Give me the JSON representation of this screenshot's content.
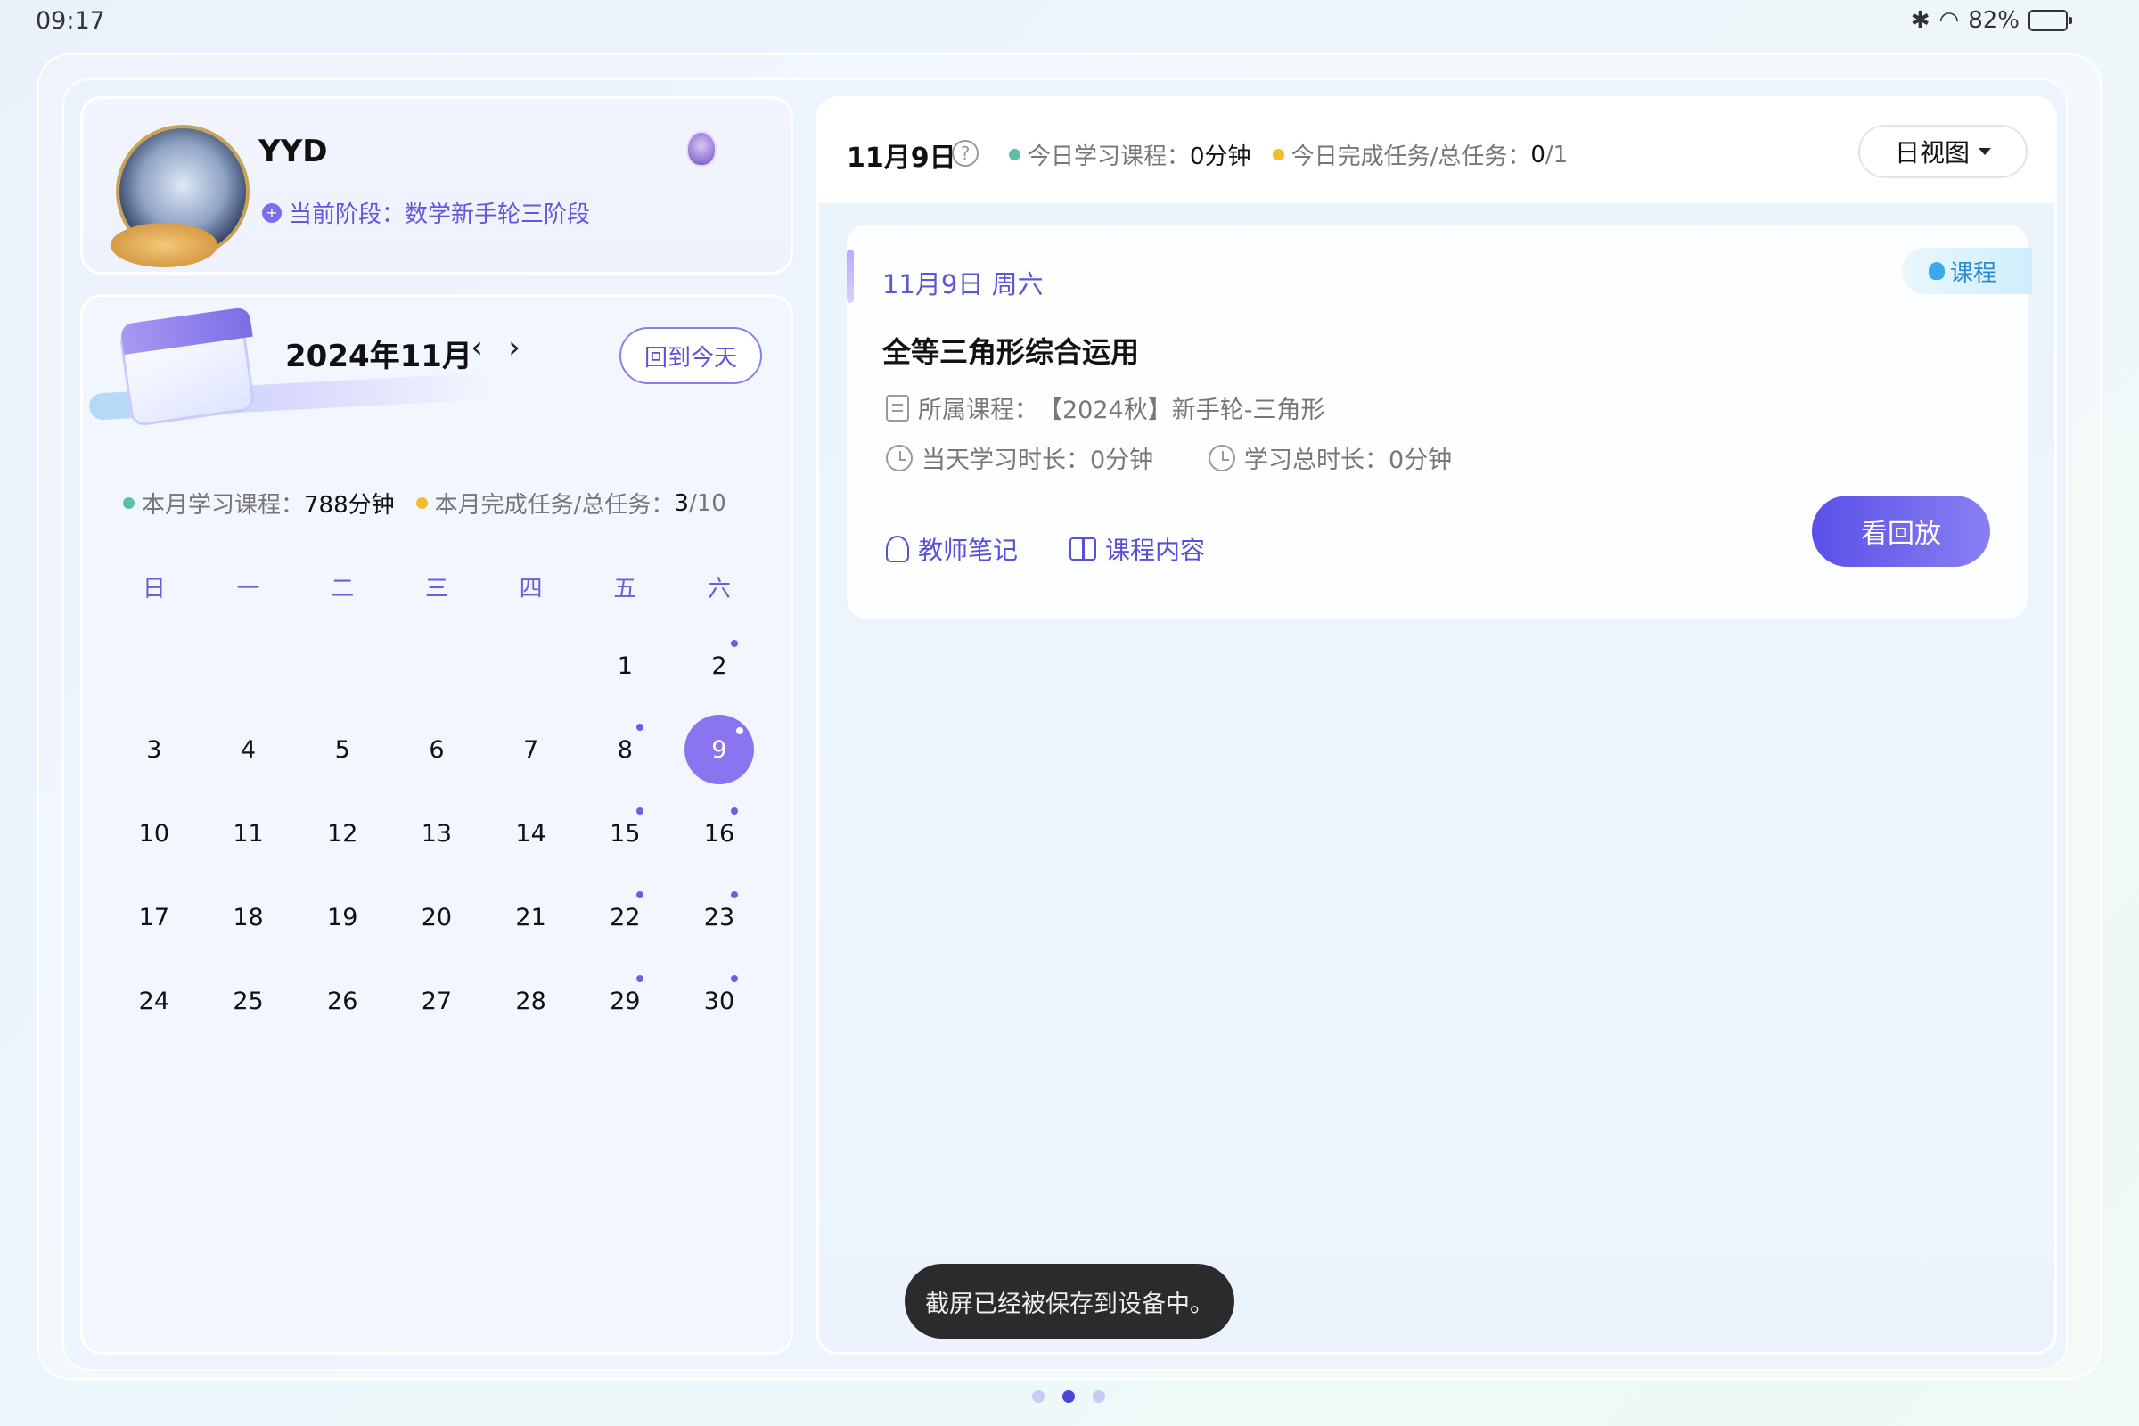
{
  "status_bar": {
    "time": "09:17",
    "battery": "82%",
    "battery_level": 0.82
  },
  "profile": {
    "name": "YYD",
    "stage": "当前阶段：数学新手轮三阶段"
  },
  "calendar": {
    "month_title": "2024年11月",
    "prev_label": "‹",
    "next_label": "›",
    "today_button": "回到今天",
    "stats": {
      "study_label": "本月学习课程：",
      "study_value": "788分钟",
      "task_label": "本月完成任务/总任务：",
      "task_done": "3",
      "task_total": "/10"
    },
    "weekdays": [
      "日",
      "一",
      "二",
      "三",
      "四",
      "五",
      "六"
    ],
    "leading_blanks": 5,
    "days": [
      {
        "n": "1",
        "mark": false
      },
      {
        "n": "2",
        "mark": true
      },
      {
        "n": "3",
        "mark": false
      },
      {
        "n": "4",
        "mark": false
      },
      {
        "n": "5",
        "mark": false
      },
      {
        "n": "6",
        "mark": false
      },
      {
        "n": "7",
        "mark": false
      },
      {
        "n": "8",
        "mark": true
      },
      {
        "n": "9",
        "mark": true,
        "selected": true
      },
      {
        "n": "10",
        "mark": false
      },
      {
        "n": "11",
        "mark": false
      },
      {
        "n": "12",
        "mark": false
      },
      {
        "n": "13",
        "mark": false
      },
      {
        "n": "14",
        "mark": false
      },
      {
        "n": "15",
        "mark": true
      },
      {
        "n": "16",
        "mark": true
      },
      {
        "n": "17",
        "mark": false
      },
      {
        "n": "18",
        "mark": false
      },
      {
        "n": "19",
        "mark": false
      },
      {
        "n": "20",
        "mark": false
      },
      {
        "n": "21",
        "mark": false
      },
      {
        "n": "22",
        "mark": true
      },
      {
        "n": "23",
        "mark": true
      },
      {
        "n": "24",
        "mark": false
      },
      {
        "n": "25",
        "mark": false
      },
      {
        "n": "26",
        "mark": false
      },
      {
        "n": "27",
        "mark": false
      },
      {
        "n": "28",
        "mark": false
      },
      {
        "n": "29",
        "mark": true
      },
      {
        "n": "30",
        "mark": true
      }
    ]
  },
  "day_header": {
    "date": "11月9日",
    "help": "?",
    "study_label": "今日学习课程：",
    "study_value": "0分钟",
    "task_label": "今日完成任务/总任务：",
    "task_done": "0",
    "task_total": "/1",
    "view_button": "日视图"
  },
  "course": {
    "date": "11月9日 周六",
    "tag": "课程",
    "title": "全等三角形综合运用",
    "belongs_label": "所属课程：",
    "belongs_value": "【2024秋】新手轮-三角形",
    "day_time_label": "当天学习时长：",
    "day_time_value": "0分钟",
    "total_time_label": "学习总时长：",
    "total_time_value": "0分钟",
    "teacher_notes": "教师笔记",
    "course_content": "课程内容",
    "replay_button": "看回放"
  },
  "toast": "截屏已经被保存到设备中。",
  "pager": {
    "count": 3,
    "active": 1
  },
  "colors": {
    "accent": "#5a4fd6",
    "selected_day": "#8b74f0",
    "green_dot": "#5cc1a4",
    "yellow_dot": "#f5bd2a"
  }
}
